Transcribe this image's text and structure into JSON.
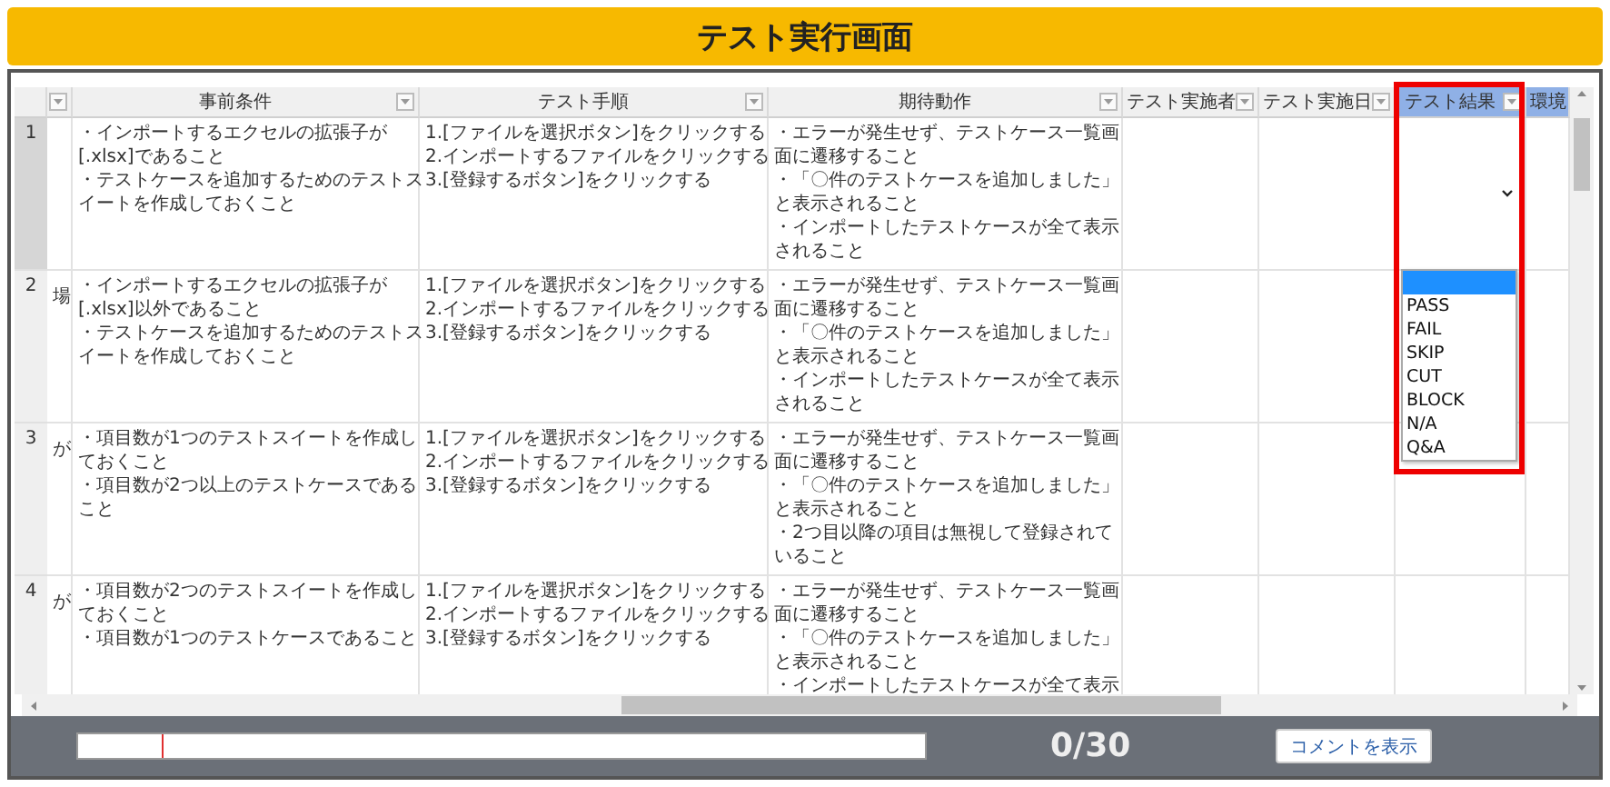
{
  "title": "テスト実行画面",
  "columns": [
    {
      "filter": true,
      "selected": false
    },
    {
      "label": "事前条件",
      "filter": true,
      "selected": false
    },
    {
      "label": "テスト手順",
      "filter": true,
      "selected": false
    },
    {
      "label": "期待動作",
      "filter": true,
      "selected": false
    },
    {
      "label": "テスト実施者",
      "filter": true,
      "selected": false
    },
    {
      "label": "テスト実施日",
      "filter": true,
      "selected": false
    },
    {
      "label": "テスト結果",
      "filter": true,
      "selected": true
    },
    {
      "label": "環境",
      "filter": false,
      "selected": true
    }
  ],
  "rows": [
    {
      "number": "1",
      "selected": true,
      "precondition": [
        "・インポートするエクセルの拡張子が",
        "[.xlsx]であること",
        "・テストケースを追加するためのテストス",
        "イートを作成しておくこと"
      ],
      "steps": [
        "1.[ファイルを選択ボタン]をクリックする",
        "2.インポートするファイルをクリックする",
        "3.[登録するボタン]をクリックする"
      ],
      "expected": [
        "・エラーが発生せず、テストケース一覧画",
        "面に遷移すること",
        "・「〇件のテストケースを追加しました」",
        "と表示されること",
        "・インポートしたテストケースが全て表示",
        "されること"
      ],
      "result": {
        "kind": "select",
        "open": true,
        "options": [
          {
            "selected": true
          },
          {
            "label": "PASS",
            "selected": false
          },
          {
            "label": "FAIL",
            "selected": false
          },
          {
            "label": "SKIP",
            "selected": false
          },
          {
            "label": "CUT",
            "selected": false
          },
          {
            "label": "BLOCK",
            "selected": false
          },
          {
            "label": "N/A",
            "selected": false
          },
          {
            "label": "Q&A",
            "selected": false
          }
        ]
      }
    },
    {
      "number": "2",
      "selected": false,
      "column_2": "場",
      "precondition": [
        "・インポートするエクセルの拡張子が",
        "[.xlsx]以外であること",
        "・テストケースを追加するためのテストス",
        "イートを作成しておくこと"
      ],
      "steps": [
        "1.[ファイルを選択ボタン]をクリックする",
        "2.インポートするファイルをクリックする",
        "3.[登録するボタン]をクリックする"
      ],
      "expected": [
        "・エラーが発生せず、テストケース一覧画",
        "面に遷移すること",
        "・「〇件のテストケースを追加しました」",
        "と表示されること",
        "・インポートしたテストケースが全て表示",
        "されること"
      ]
    },
    {
      "number": "3",
      "selected": false,
      "column_2": "が",
      "precondition": [
        "・項目数が1つのテストスイートを作成し",
        "ておくこと",
        "・項目数が2つ以上のテストケースである",
        "こと"
      ],
      "steps": [
        "1.[ファイルを選択ボタン]をクリックする",
        "2.インポートするファイルをクリックする",
        "3.[登録するボタン]をクリックする"
      ],
      "expected": [
        "・エラーが発生せず、テストケース一覧画",
        "面に遷移すること",
        "・「〇件のテストケースを追加しました」",
        "と表示されること",
        "・2つ目以降の項目は無視して登録されて",
        "いること"
      ]
    },
    {
      "number": "4",
      "selected": false,
      "column_2": "が",
      "precondition": [
        "・項目数が2つのテストスイートを作成し",
        "ておくこと",
        "・項目数が1つのテストケースであること"
      ],
      "steps": [
        "1.[ファイルを選択ボタン]をクリックする",
        "2.インポートするファイルをクリックする",
        "3.[登録するボタン]をクリックする"
      ],
      "expected": [
        "・エラーが発生せず、テストケース一覧画",
        "面に遷移すること",
        "・「〇件のテストケースを追加しました」",
        "と表示されること",
        "・インポートしたテストケースが全て表示"
      ]
    }
  ],
  "counter": "0/30",
  "comment_button": "コメントを表示"
}
